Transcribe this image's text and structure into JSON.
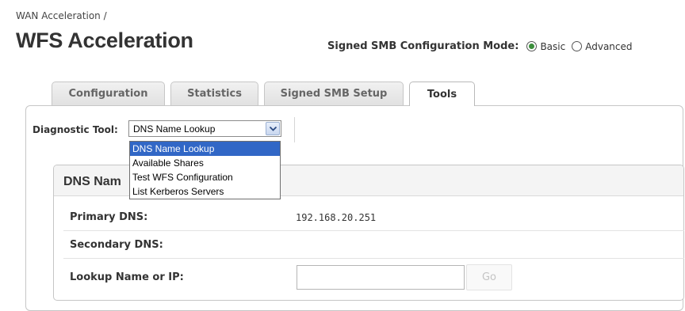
{
  "breadcrumb": "WAN Acceleration /",
  "page_title": "WFS Acceleration",
  "mode": {
    "label": "Signed SMB Configuration Mode:",
    "options": [
      "Basic",
      "Advanced"
    ],
    "selected": "Basic"
  },
  "tabs": [
    {
      "label": "Configuration"
    },
    {
      "label": "Statistics"
    },
    {
      "label": "Signed SMB Setup"
    },
    {
      "label": "Tools",
      "active": true
    }
  ],
  "diagnostic": {
    "label": "Diagnostic Tool:",
    "selected": "DNS Name Lookup",
    "options": [
      "DNS Name Lookup",
      "Available Shares",
      "Test WFS Configuration",
      "List Kerberos Servers"
    ]
  },
  "section": {
    "title": "DNS Nam",
    "rows": [
      {
        "label": "Primary DNS:",
        "value": "192.168.20.251"
      },
      {
        "label": "Secondary DNS:",
        "value": ""
      },
      {
        "label": "Lookup Name or IP:",
        "value": ""
      }
    ],
    "go_label": "Go"
  },
  "colors": {
    "selected_item": "#3167c6",
    "radio_dot": "#3b8e3b"
  }
}
